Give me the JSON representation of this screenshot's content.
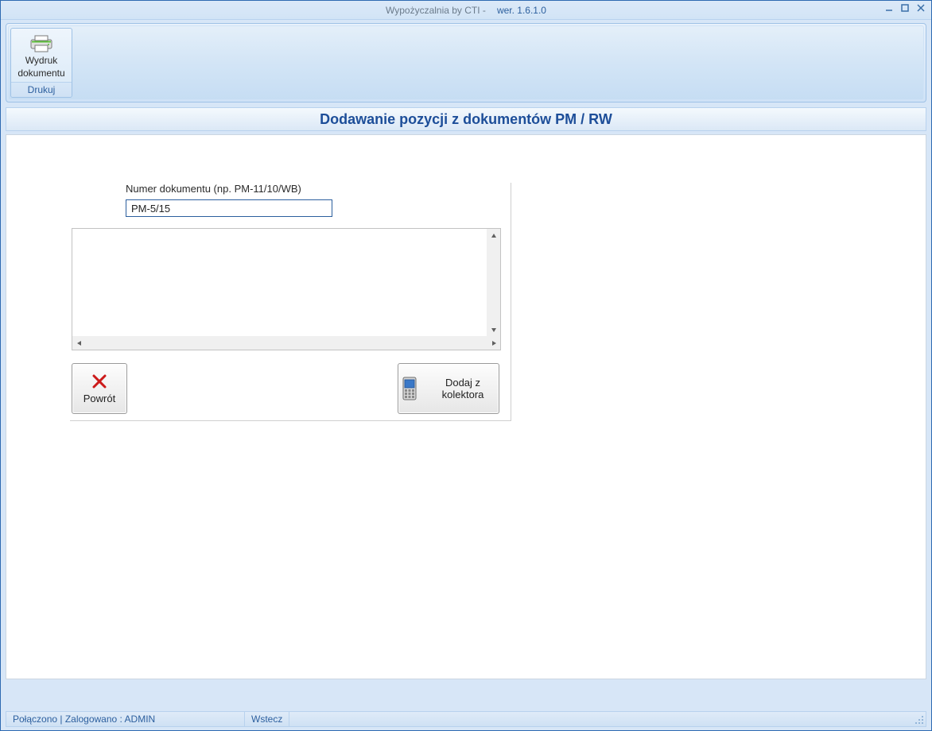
{
  "titlebar": {
    "app_name": "Wypożyczalnia by CTI -",
    "version": "wer. 1.6.1.0"
  },
  "ribbon": {
    "print_button": {
      "label_line1": "Wydruk",
      "label_line2": "dokumentu",
      "icon": "printer-icon"
    },
    "group_label": "Drukuj"
  },
  "section": {
    "header": "Dodawanie pozycji z dokumentów PM / RW"
  },
  "form": {
    "doc_number_label": "Numer dokumentu (np. PM-11/10/WB)",
    "doc_number_value": "PM-5/15",
    "list_items": [],
    "back_button": "Powrót",
    "collector_button": "Dodaj z kolektora"
  },
  "statusbar": {
    "connection": "Połączono | Zalogowano : ADMIN",
    "back": "Wstecz"
  },
  "colors": {
    "accent": "#2c5f9e"
  }
}
